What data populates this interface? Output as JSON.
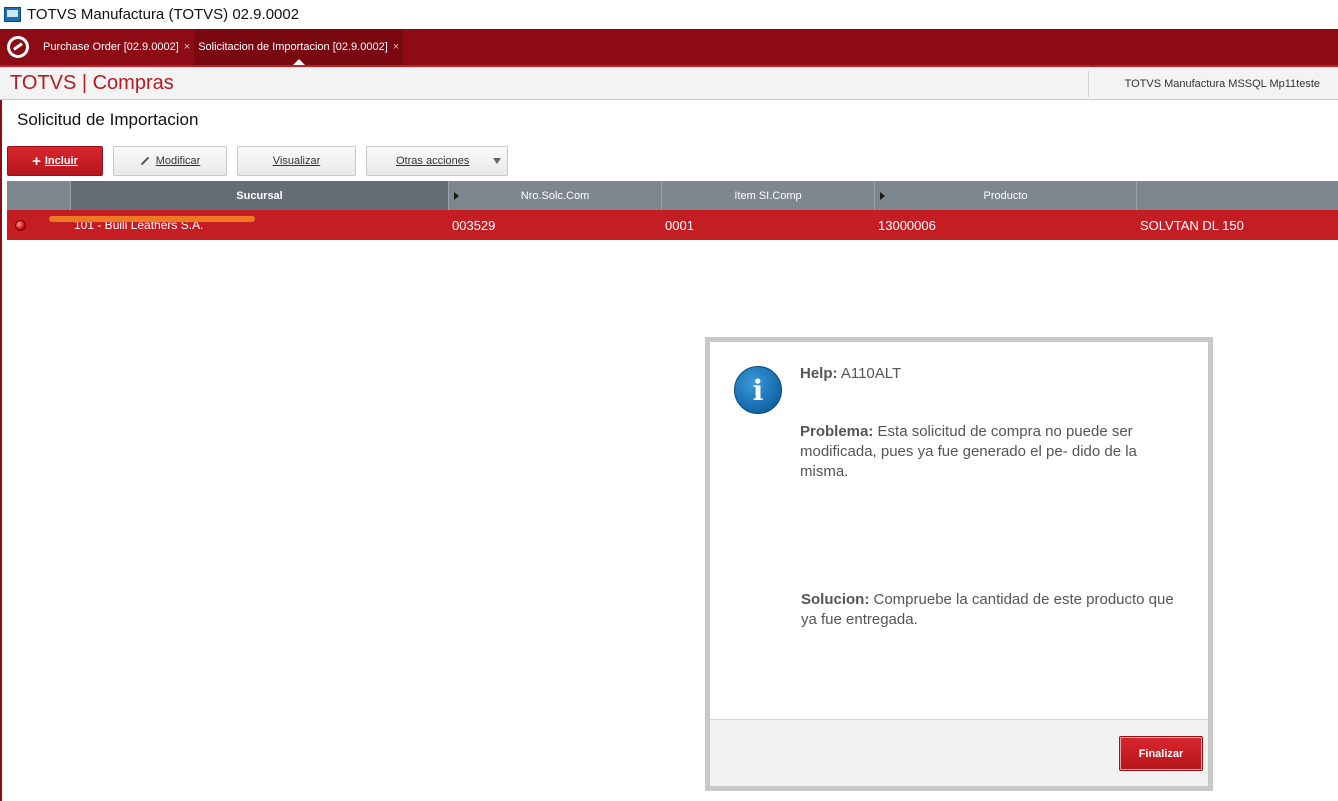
{
  "window": {
    "title": "TOTVS Manufactura (TOTVS) 02.9.0002"
  },
  "tabs": [
    {
      "label": "Purchase Order [02.9.0002]",
      "close": "×"
    },
    {
      "label": "Solicitacion de Importacion [02.9.0002]",
      "close": "×"
    }
  ],
  "module": {
    "title": "TOTVS | Compras",
    "environment": "TOTVS Manufactura MSSQL Mp11teste"
  },
  "page": {
    "title": "Solicitud de Importacion"
  },
  "toolbar": {
    "incluir": "Incluir",
    "modificar": "Modificar",
    "visualizar": "Visualizar",
    "otras": "Otras acciones"
  },
  "grid": {
    "columns": [
      "Sucursal",
      "Nro.Solc.Com",
      "Item SI.Comp",
      "Producto",
      ""
    ],
    "rows": [
      {
        "sucursal": "101 - Buili Leathers S.A.",
        "nro": "003529",
        "item": "0001",
        "producto": "13000006",
        "descripcion": "SOLVTAN DL 150"
      }
    ]
  },
  "dialog": {
    "help_label": "Help:",
    "help_code": "A110ALT",
    "problema_label": "Problema:",
    "problema_text": "Esta solicitud de compra no puede ser modificada, pues ya fue generado el pe- dido de la misma.",
    "solucion_label": "Solucion:",
    "solucion_text": "Compruebe la cantidad de este producto que ya fue entregada.",
    "button": "Finalizar",
    "icon": "info-icon"
  },
  "colors": {
    "brand_red": "#c41d24",
    "dark_red": "#8d0b14",
    "info_blue": "#1367a8"
  }
}
